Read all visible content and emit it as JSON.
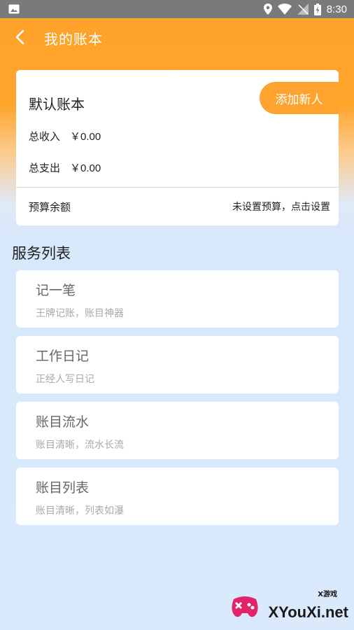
{
  "status_bar": {
    "time": "8:30"
  },
  "header": {
    "title": "我的账本",
    "back_icon": "chevron-left-icon"
  },
  "account": {
    "name": "默认账本",
    "add_member_label": "添加新人",
    "income_label": "总收入",
    "income_value": "￥0.00",
    "expense_label": "总支出",
    "expense_value": "￥0.00",
    "budget_label": "预算余额",
    "budget_action": "未设置预算，点击设置"
  },
  "services": {
    "heading": "服务列表",
    "items": [
      {
        "title": "记一笔",
        "desc": "王牌记账，账目神器"
      },
      {
        "title": "工作日记",
        "desc": "正经人写日记"
      },
      {
        "title": "账目流水",
        "desc": "账目清晰，流水长流"
      },
      {
        "title": "账目列表",
        "desc": "账目清晰，列表如瀑"
      }
    ]
  },
  "watermark": {
    "mini": "X游戏",
    "text": "XYouXi.net"
  },
  "colors": {
    "accent": "#FFA32F",
    "background": "#DAEAFC",
    "status_bar": "#7A7A7A"
  }
}
